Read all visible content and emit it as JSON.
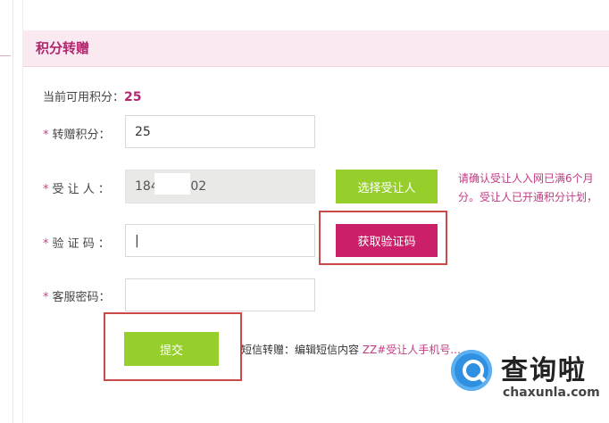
{
  "panel": {
    "title": "积分转赠"
  },
  "available": {
    "label": "当前可用积分：",
    "value": "25"
  },
  "form": {
    "points": {
      "label": "转赠积分：",
      "value": "25"
    },
    "recipient": {
      "label": "受 让 人 ：",
      "value": "184    3602",
      "select_button": "选择受让人"
    },
    "code": {
      "label": "验 证 码 ：",
      "value": "|",
      "get_code_button": "获取验证码"
    },
    "service_password": {
      "label": "客服密码：",
      "value": ""
    },
    "required_mark": "*",
    "submit_label": "提交"
  },
  "notice": {
    "line1": "请确认受让人入网已满6个月",
    "line2": "分。受让人已开通积分计划，"
  },
  "sms_hint": {
    "text": "短信转赠：编辑短信内容 ",
    "format": "ZZ#受让人手机号..."
  },
  "watermark": {
    "name": "查询啦",
    "domain": "chaxunla.com"
  },
  "colors": {
    "accent": "#b0286e",
    "green_button": "#96cf2c",
    "pink_button": "#cc1f6a",
    "header_bg": "#fbe9f1"
  }
}
